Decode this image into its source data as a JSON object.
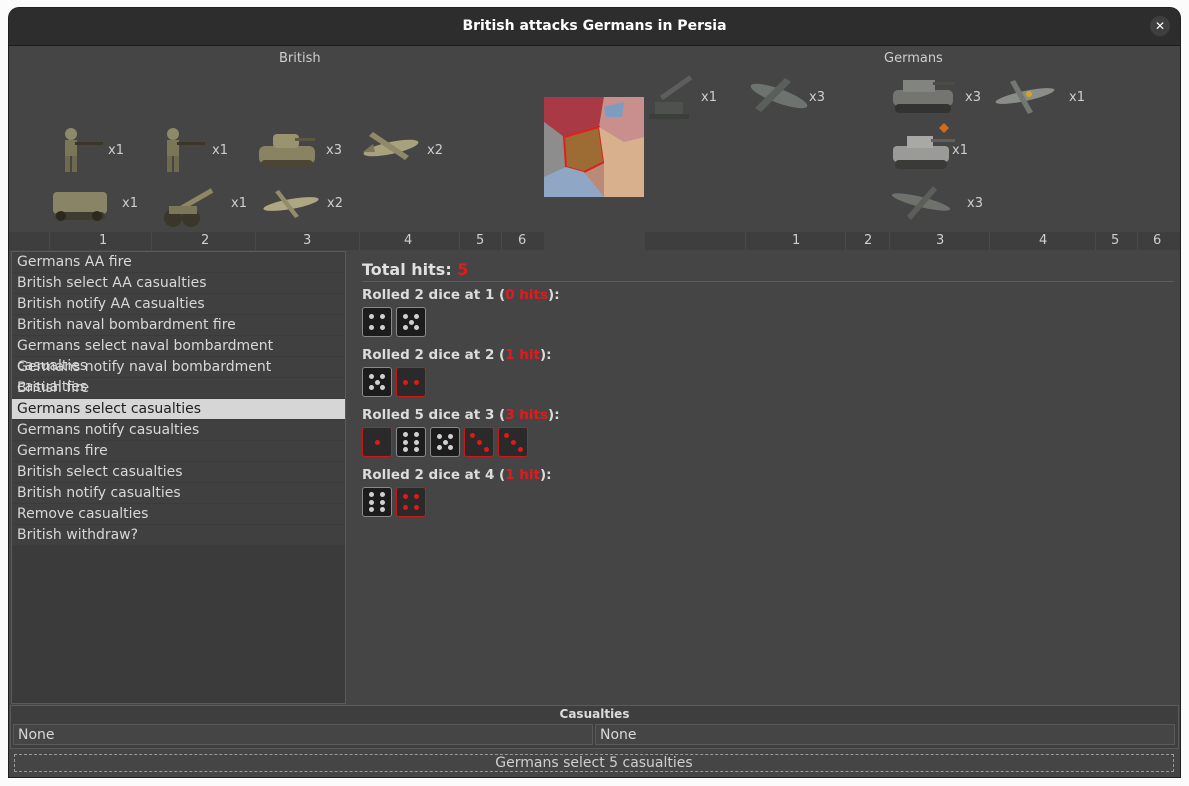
{
  "window": {
    "title": "British attacks Germans in Persia"
  },
  "british": {
    "label": "British",
    "units": [
      {
        "name": "infantry",
        "count": "x1"
      },
      {
        "name": "infantry",
        "count": "x1"
      },
      {
        "name": "tank",
        "count": "x3"
      },
      {
        "name": "bomber",
        "count": "x2"
      },
      {
        "name": "halftrack",
        "count": "x1"
      },
      {
        "name": "artillery",
        "count": "x1"
      },
      {
        "name": "fighter",
        "count": "x2"
      }
    ],
    "columns": [
      "1",
      "2",
      "3",
      "4",
      "5",
      "6"
    ]
  },
  "germans": {
    "label": "Germans",
    "units": [
      {
        "name": "aa-gun",
        "count": "x1"
      },
      {
        "name": "bomber",
        "count": "x3"
      },
      {
        "name": "tank",
        "count": "x3"
      },
      {
        "name": "fighter",
        "count": "x1"
      },
      {
        "name": "heavy-tank",
        "count": "x1"
      },
      {
        "name": "fighter",
        "count": "x3"
      }
    ],
    "columns": [
      "1",
      "2",
      "3",
      "4",
      "5",
      "6"
    ]
  },
  "phases": [
    "Germans AA fire",
    "British select AA casualties",
    "British notify AA casualties",
    "British naval bombardment fire",
    "Germans select naval bombardment casualties",
    "Germans notify naval bombardment casualties",
    "British fire",
    "Germans select casualties",
    "Germans notify casualties",
    "Germans fire",
    "British select casualties",
    "British notify casualties",
    "Remove casualties",
    "British withdraw?"
  ],
  "selected_phase": 7,
  "rolls": {
    "total_label": "Total hits: ",
    "total_value": "5",
    "groups": [
      {
        "prefix": "Rolled 2 dice at 1 (",
        "hits": "0 hits",
        "suffix": "):",
        "dice": [
          {
            "value": 4,
            "hit": false
          },
          {
            "value": 5,
            "hit": false
          }
        ]
      },
      {
        "prefix": "Rolled 2 dice at 2 (",
        "hits": "1 hit",
        "suffix": "):",
        "dice": [
          {
            "value": 5,
            "hit": false
          },
          {
            "value": 2,
            "hit": true
          }
        ]
      },
      {
        "prefix": "Rolled 5 dice at 3 (",
        "hits": "3 hits",
        "suffix": "):",
        "dice": [
          {
            "value": 1,
            "hit": true
          },
          {
            "value": 6,
            "hit": false
          },
          {
            "value": 5,
            "hit": false
          },
          {
            "value": 3,
            "hit": true
          },
          {
            "value": 3,
            "hit": true
          }
        ]
      },
      {
        "prefix": "Rolled 2 dice at 4 (",
        "hits": "1 hit",
        "suffix": "):",
        "dice": [
          {
            "value": 6,
            "hit": false
          },
          {
            "value": 4,
            "hit": true
          }
        ]
      }
    ]
  },
  "casualties": {
    "header": "Casualties",
    "british": "None",
    "germans": "None"
  },
  "status": "Germans select 5 casualties",
  "colors": {
    "hit_red": "#e5191b",
    "window_bg": "#454545"
  }
}
